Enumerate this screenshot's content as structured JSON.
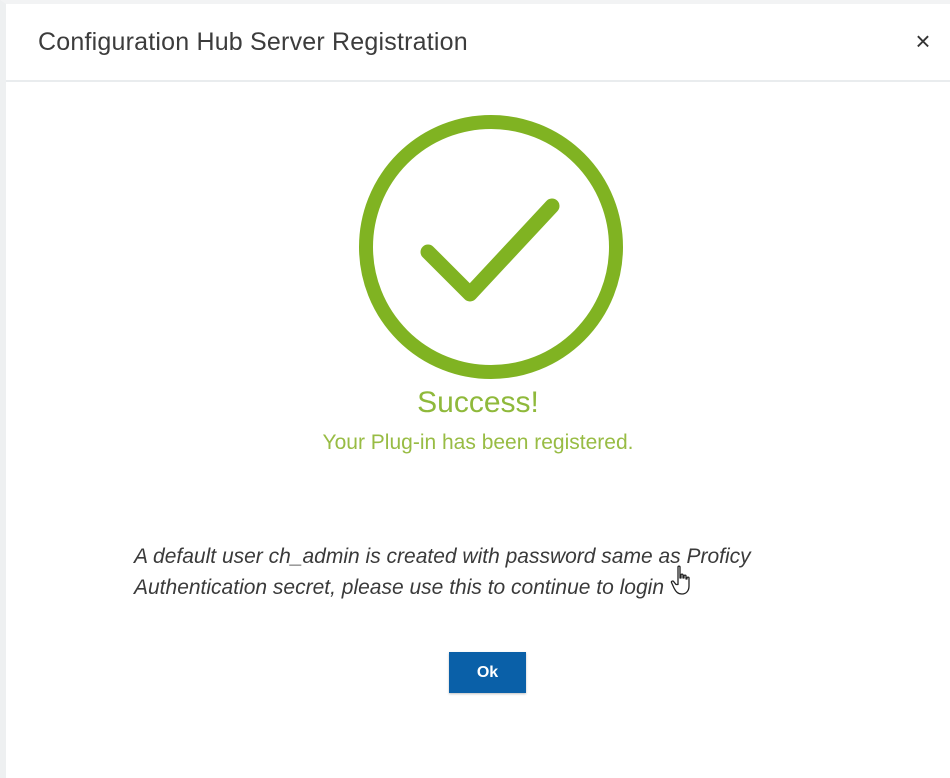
{
  "dialog": {
    "title": "Configuration Hub Server Registration",
    "close_glyph": "×",
    "close_icon": "close-icon"
  },
  "status": {
    "icon": "check-circle-icon",
    "accent_color": "#80b322",
    "title": "Success!",
    "message": "Your Plug-in has been registered."
  },
  "info": {
    "text": "A default user ch_admin is created with password same as Proficy Authentication secret, please use this to continue to login"
  },
  "actions": {
    "ok_label": "Ok",
    "ok_color": "#0a60a8"
  },
  "pointer": {
    "icon": "hand-cursor-icon"
  }
}
